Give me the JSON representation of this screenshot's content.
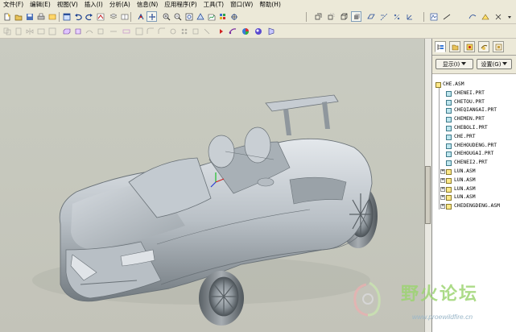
{
  "menubar": {
    "items": [
      "文件(F)",
      "编辑(E)",
      "视图(V)",
      "插入(I)",
      "分析(A)",
      "信息(N)",
      "应用程序(P)",
      "工具(T)",
      "窗口(W)",
      "帮助(H)"
    ]
  },
  "toolbar": {
    "icons": [
      "new-icon",
      "open-icon",
      "save-icon",
      "print-icon",
      "repaint-icon",
      "undo-icon",
      "redo-icon",
      "regenerate-icon",
      "window-icon",
      "spin-center-icon",
      "orient-icon",
      "zoom-in-icon",
      "zoom-out-icon",
      "refit-icon",
      "reorient-icon",
      "saved-views-icon",
      "layers-icon",
      "model-setup-icon",
      "wireframe-icon",
      "hidden-line-icon",
      "no-hidden-icon",
      "shading-icon",
      "datum-planes-icon",
      "datum-axes-icon",
      "datum-points-icon",
      "coordinate-systems-icon",
      "sketch-icon",
      "datum-curve-icon",
      "insert-datum-icon"
    ],
    "accent": "#1f5fbf"
  },
  "panel": {
    "show_label": "显示(I)",
    "settings_label": "设置(G)",
    "tabs": [
      "model-tree-tab",
      "folder-browser-tab",
      "favorites-tab",
      "connections-tab",
      "layers-tab"
    ]
  },
  "tree": {
    "root": "CHE.ASM",
    "children": [
      {
        "label": "CHENEI.PRT",
        "type": "part",
        "expandable": false
      },
      {
        "label": "CHETOU.PRT",
        "type": "part",
        "expandable": false
      },
      {
        "label": "CHEQIANGAI.PRT",
        "type": "part",
        "expandable": false
      },
      {
        "label": "CHEMEN.PRT",
        "type": "part",
        "expandable": false
      },
      {
        "label": "CHEBOLI.PRT",
        "type": "part",
        "expandable": false
      },
      {
        "label": "CHE.PRT",
        "type": "part",
        "expandable": false
      },
      {
        "label": "CHEHOUDENG.PRT",
        "type": "part",
        "expandable": false
      },
      {
        "label": "CHEHOUGAI.PRT",
        "type": "part",
        "expandable": false
      },
      {
        "label": "CHENEI2.PRT",
        "type": "part",
        "expandable": false
      },
      {
        "label": "LUN.ASM",
        "type": "assembly",
        "expandable": true
      },
      {
        "label": "LUN.ASM",
        "type": "assembly",
        "expandable": true
      },
      {
        "label": "LUN.ASM",
        "type": "assembly",
        "expandable": true
      },
      {
        "label": "LUN.ASM",
        "type": "assembly",
        "expandable": true
      },
      {
        "label": "CHEDENGDENG.ASM",
        "type": "assembly",
        "expandable": true
      }
    ]
  },
  "watermark": {
    "site_name": "野火论坛",
    "url": "www.proewildfire.cn",
    "color": "#9bd46f"
  }
}
